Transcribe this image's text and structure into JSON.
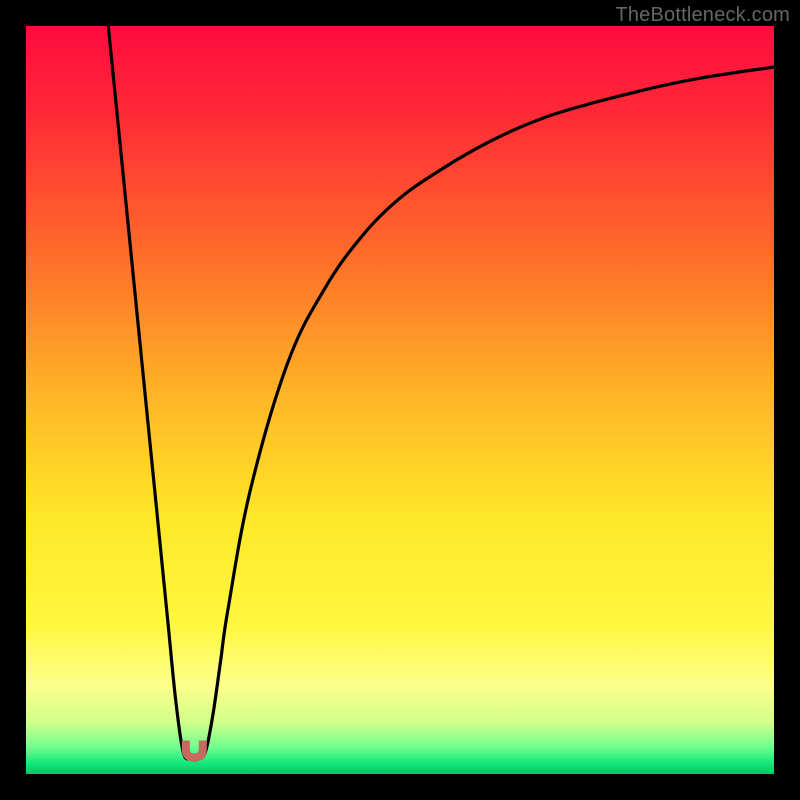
{
  "attribution": "TheBottleneck.com",
  "chart_data": {
    "type": "line",
    "title": "",
    "xlabel": "",
    "ylabel": "",
    "xlim": [
      0,
      100
    ],
    "ylim": [
      0,
      100
    ],
    "gradient_stops": [
      {
        "offset": 0,
        "color": "#ff0b3f"
      },
      {
        "offset": 0.12,
        "color": "#ff2a36"
      },
      {
        "offset": 0.3,
        "color": "#ff6a2a"
      },
      {
        "offset": 0.5,
        "color": "#ffb726"
      },
      {
        "offset": 0.66,
        "color": "#ffe829"
      },
      {
        "offset": 0.8,
        "color": "#fff73f"
      },
      {
        "offset": 0.88,
        "color": "#fdff8a"
      },
      {
        "offset": 0.93,
        "color": "#d3ff8a"
      },
      {
        "offset": 0.965,
        "color": "#6eff90"
      },
      {
        "offset": 0.985,
        "color": "#17e87a"
      },
      {
        "offset": 1.0,
        "color": "#00c766"
      }
    ],
    "series": [
      {
        "name": "bottleneck-curve",
        "x": [
          11,
          12,
          13,
          14,
          15,
          16,
          17,
          18,
          19,
          20,
          21,
          22,
          23,
          24,
          25,
          26,
          27,
          30,
          35,
          40,
          45,
          50,
          55,
          60,
          65,
          70,
          75,
          80,
          85,
          90,
          95,
          100
        ],
        "y": [
          100,
          90,
          80,
          70,
          60,
          50,
          40,
          30,
          20,
          10,
          3,
          2,
          2,
          3,
          8,
          15,
          22,
          38,
          55,
          65,
          72,
          77,
          80.5,
          83.5,
          86,
          88,
          89.5,
          90.8,
          92,
          93,
          93.8,
          94.5
        ]
      }
    ],
    "marker": {
      "cx": 22.5,
      "cy": 2.0,
      "description": "minimum / optimal point"
    },
    "colors": {
      "curve_stroke": "#000000",
      "marker_fill": "#c66a5e",
      "background_frame": "#000000"
    }
  }
}
